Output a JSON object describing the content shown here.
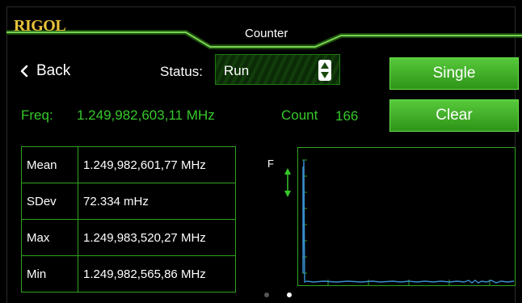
{
  "header": {
    "logo": "RIGOL",
    "title": "Counter"
  },
  "nav": {
    "back_label": "Back",
    "back_icon": "chevron-left-icon"
  },
  "status": {
    "label": "Status:",
    "value": "Run",
    "spinner_icon": "up-down-arrows-icon"
  },
  "buttons": {
    "single": "Single",
    "clear": "Clear"
  },
  "readout": {
    "freq_label": "Freq:",
    "freq_value": "1.249,982,603,11 MHz",
    "count_label": "Count",
    "count_value": "166"
  },
  "stats": [
    {
      "label": "Mean",
      "value": "1.249,982,601,77 MHz"
    },
    {
      "label": "SDev",
      "value": "72.334 mHz"
    },
    {
      "label": "Max",
      "value": "1.249,983,520,27 MHz"
    },
    {
      "label": "Min",
      "value": "1.249,982,565,86 MHz"
    }
  ],
  "plot": {
    "axis_label": "F"
  },
  "pager": {
    "pages": 2,
    "active_page": 2
  },
  "colors": {
    "accent_green": "#36c82a",
    "button_green": "#3fae25",
    "logo_gold": "#e8c23a",
    "trace_blue": "#3a8fd0",
    "background": "#000000"
  }
}
